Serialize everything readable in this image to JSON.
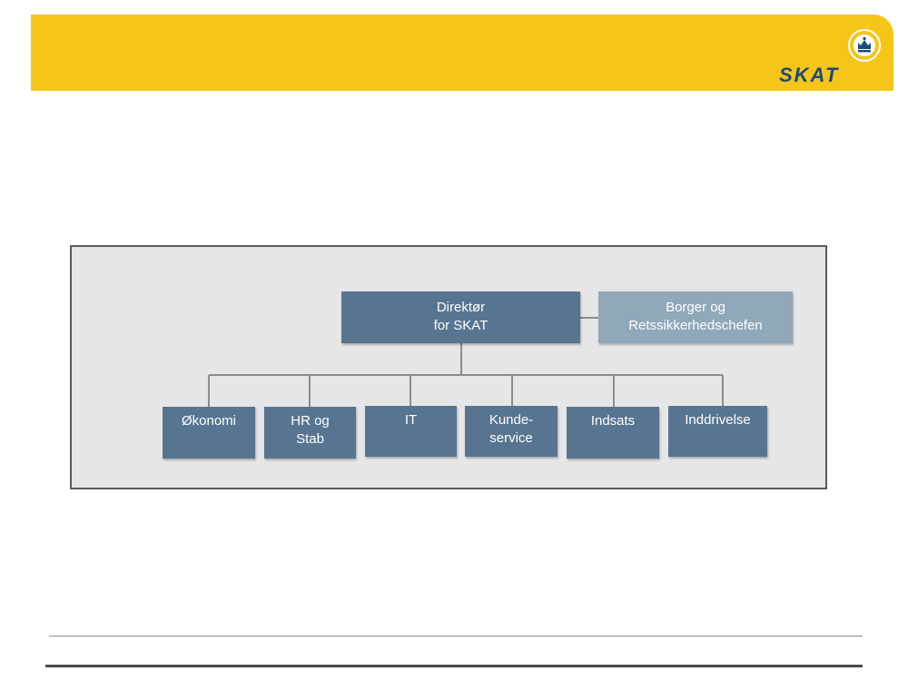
{
  "header": {
    "logo_text": "SKAT",
    "brand_color": "#f5c518",
    "logo_icon": "crown-icon"
  },
  "org_chart": {
    "top": {
      "label": "Direktør\nfor SKAT"
    },
    "assistant": {
      "label": "Borger og\nRetssikkerhedschefen"
    },
    "departments": [
      {
        "label": "Økonomi"
      },
      {
        "label": "HR og\nStab"
      },
      {
        "label": "IT"
      },
      {
        "label": "Kunde-\nservice"
      },
      {
        "label": "Indsats"
      },
      {
        "label": "Inddrivelse"
      }
    ],
    "colors": {
      "box_dark": "#577590",
      "box_light": "#8fa8ba",
      "background": "#e6e6e6",
      "connector": "#8c8c8c"
    }
  }
}
